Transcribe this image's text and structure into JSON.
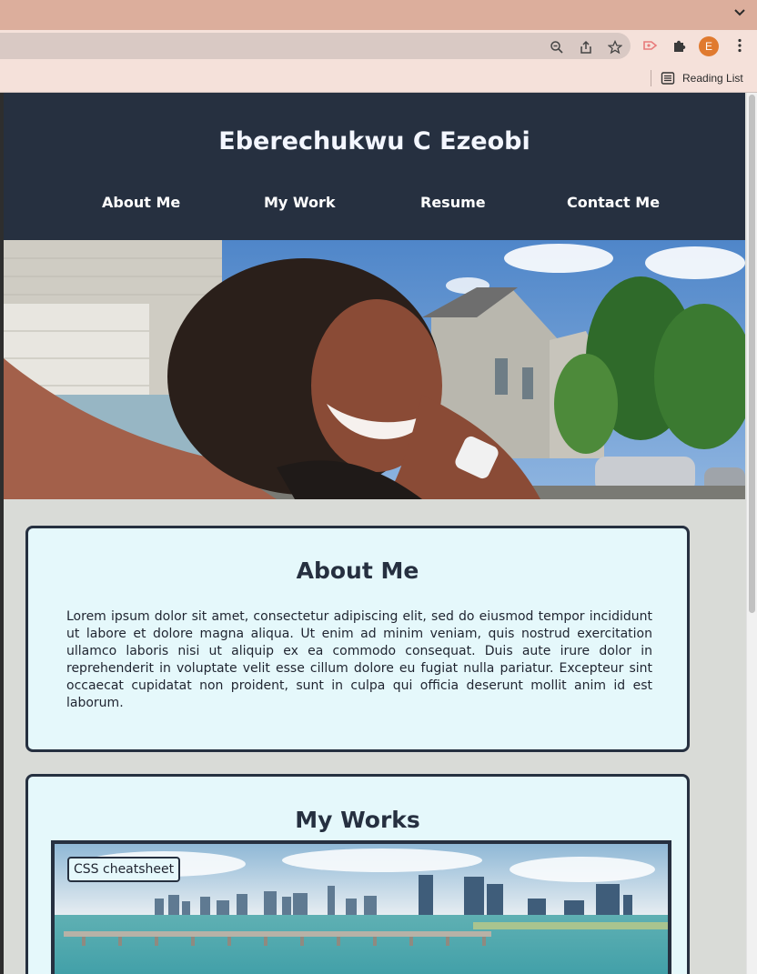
{
  "browser": {
    "reading_list_label": "Reading List",
    "profile_initial": "E"
  },
  "site": {
    "title": "Eberechukwu C Ezeobi",
    "nav": [
      "About Me",
      "My Work",
      "Resume",
      "Contact Me"
    ]
  },
  "about": {
    "heading": "About Me",
    "body": "Lorem ipsum dolor sit amet, consectetur adipiscing elit, sed do eiusmod tempor incididunt ut labore et dolore magna aliqua. Ut enim ad minim veniam, quis nostrud exercitation ullamco laboris nisi ut aliquip ex ea commodo consequat. Duis aute irure dolor in reprehenderit in voluptate velit esse cillum dolore eu fugiat nulla pariatur. Excepteur sint occaecat cupidatat non proident, sunt in culpa qui officia deserunt mollit anim id est laborum."
  },
  "works": {
    "heading": "My Works",
    "items": [
      {
        "label": "CSS cheatsheet"
      }
    ]
  },
  "colors": {
    "header_bg": "#263040",
    "card_bg": "#e5f8fb",
    "page_bg": "#d9dbd7",
    "chrome_tab": "#dcae9c",
    "chrome_bar": "#f5e1da"
  }
}
